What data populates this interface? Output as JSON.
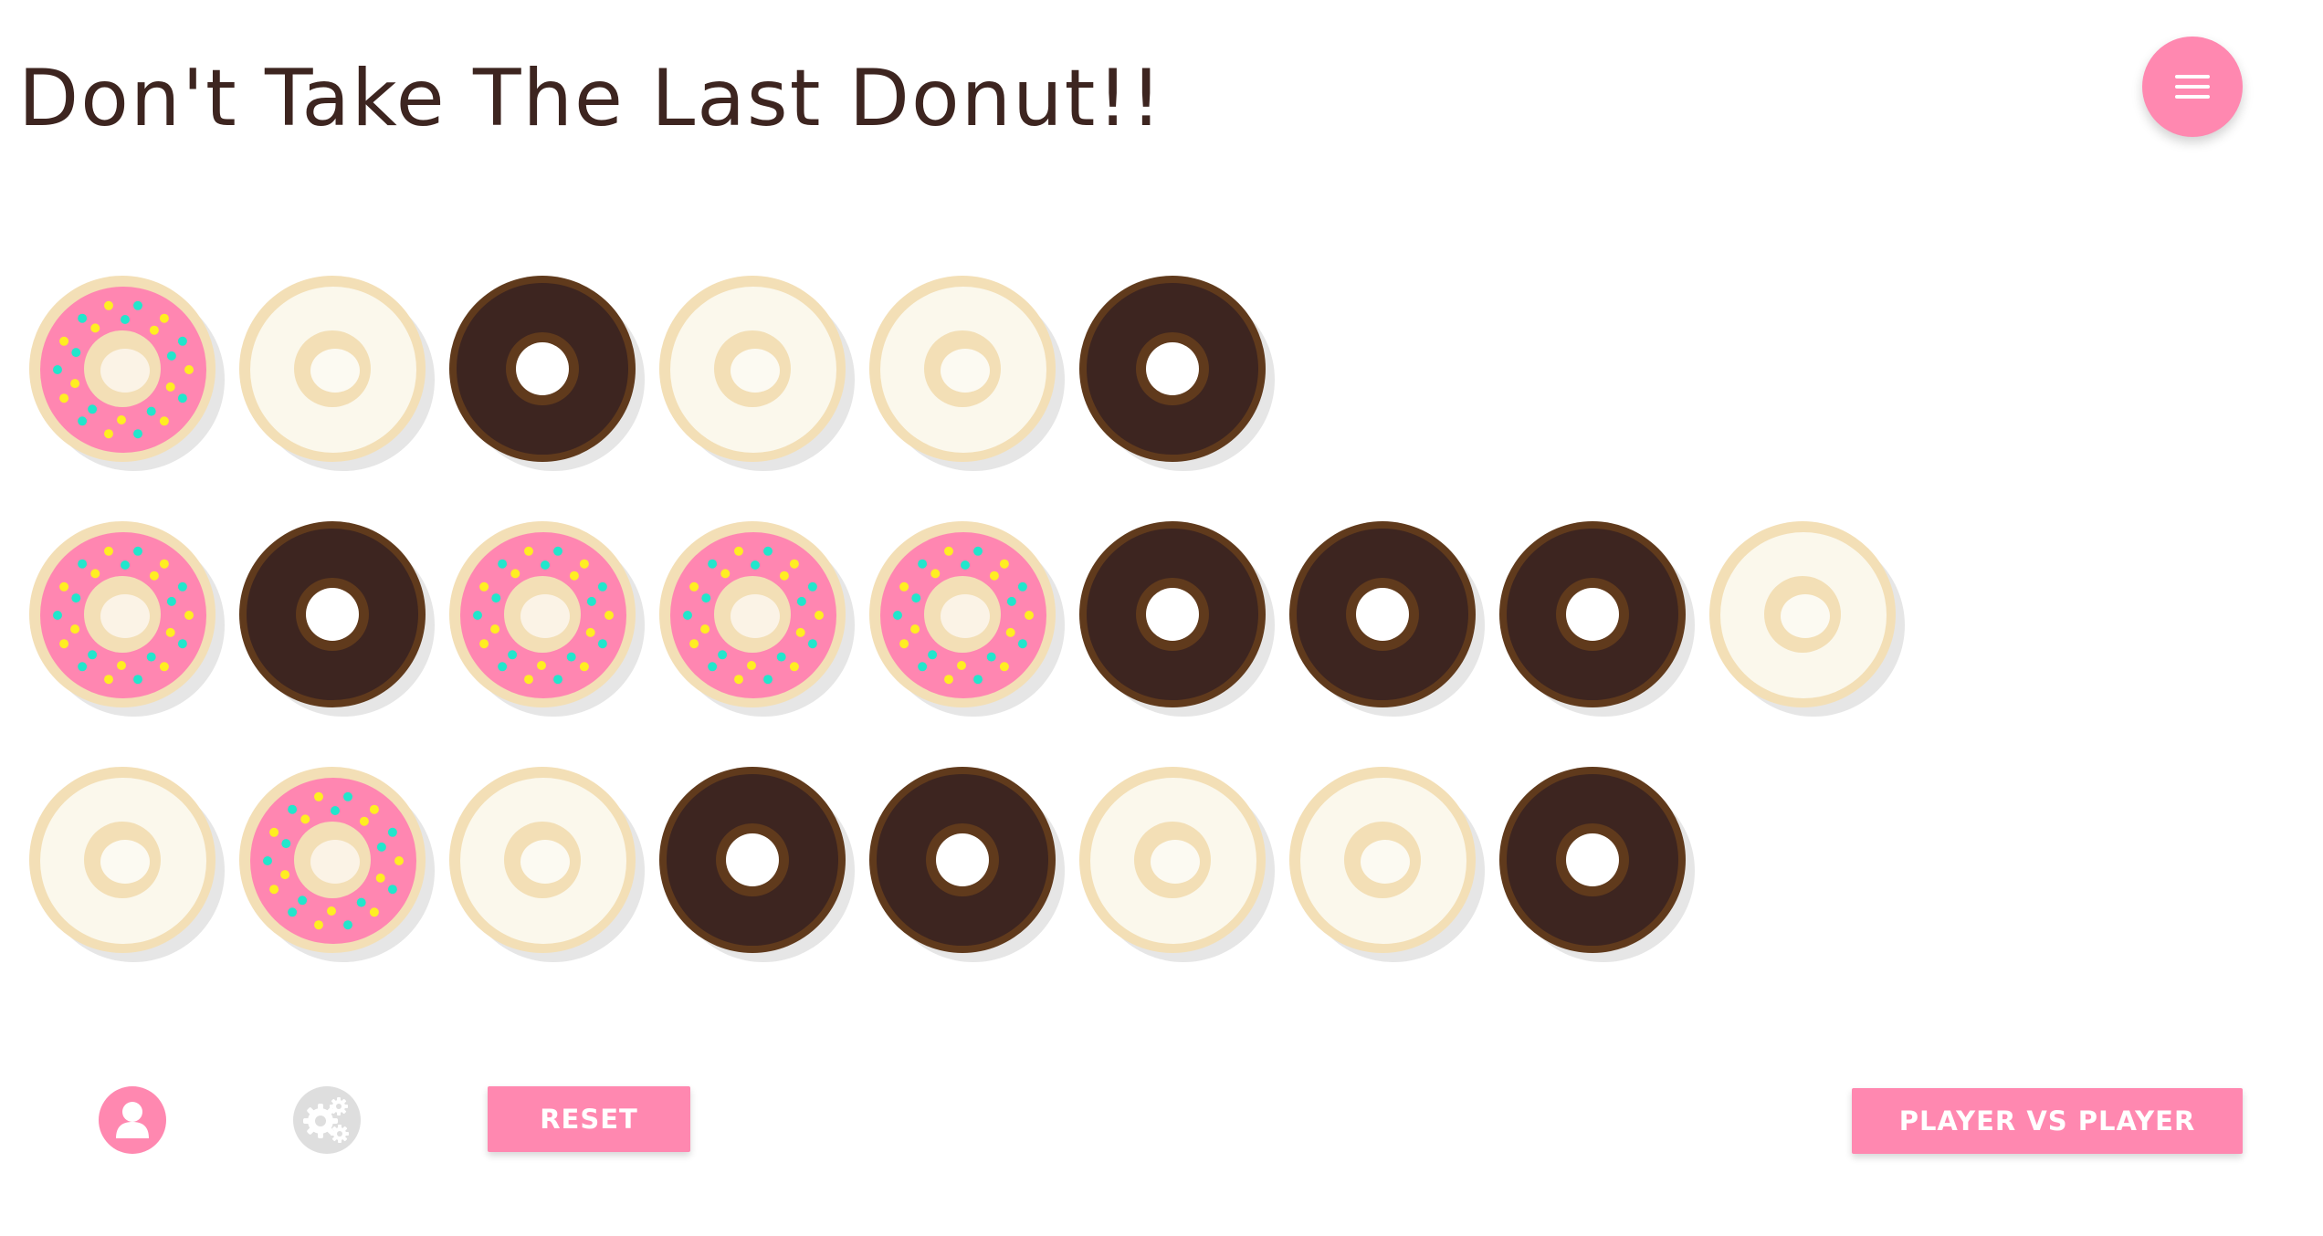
{
  "header": {
    "title": "Don't Take The Last Donut!!",
    "menu_icon": "hamburger-menu-icon"
  },
  "board": {
    "rows": [
      [
        "pink",
        "glazed",
        "chocolate",
        "glazed",
        "glazed",
        "chocolate"
      ],
      [
        "pink",
        "chocolate",
        "pink",
        "pink",
        "pink",
        "chocolate",
        "chocolate",
        "chocolate",
        "glazed"
      ],
      [
        "glazed",
        "pink",
        "glazed",
        "chocolate",
        "chocolate",
        "glazed",
        "glazed",
        "chocolate"
      ]
    ]
  },
  "footer": {
    "player_icon": "user-icon",
    "settings_icon": "gears-icon",
    "reset_label": "RESET",
    "mode_label": "PLAYER VS PLAYER"
  },
  "colors": {
    "accent": "#ff88b0",
    "title_text": "#3d2520",
    "dough": "#f3dfb6",
    "glaze": "#fbf8ec",
    "pink_frosting": "#ff86b1",
    "chocolate_frosting": "#3d2520",
    "chocolate_rim": "#603a1c",
    "sprinkle_yellow": "#ffee22",
    "sprinkle_teal": "#22e6cc",
    "shadow": "#e6e6e6"
  }
}
